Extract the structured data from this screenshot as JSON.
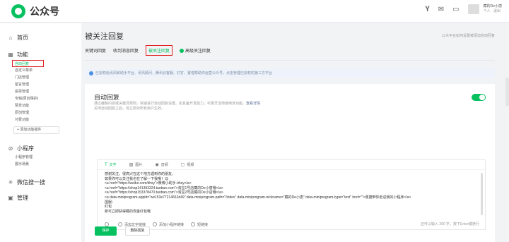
{
  "app": {
    "name": "公众号"
  },
  "topbar": {
    "icons": [
      "y-icon",
      "mail-icon",
      "monitor-icon"
    ],
    "user_name": "藏的De小唐",
    "user_sub": "个人 · 退出"
  },
  "sidebar": {
    "home": "首页",
    "features": "功能",
    "feature_items": [
      "自动回复",
      "自定义菜单",
      "门店管理",
      "留言管理",
      "投票管理",
      "专辑(原创保护)",
      "赞赏功能",
      "原创管理",
      "付费功能"
    ],
    "plugin_button": "+ 添加功能插件",
    "mini_program": "小程序",
    "mini_items": [
      "小程序管理",
      "展示场景"
    ],
    "search": "微信搜一搜",
    "manage": "管理"
  },
  "main": {
    "title": "被关注回复",
    "top_link": "公众平台如何设置被添加自动回复",
    "tabs": [
      "关键词回复",
      "收到消息回复",
      "被关注回复",
      "高级关注回复"
    ],
    "notice": "已授权给讯风和助手平台、讯风顾问、腾讯云客服、钉钉、置惜帮助你运营公众号，点击管理已授权的第三方平台"
  },
  "card": {
    "title": "自动回复",
    "desc1": "通过编辑内容或关键词规则，快速进行自动回复设置。如具备开发能力，可更灵活地使用该功能。",
    "desc_link": "查看详情",
    "desc2": "关闭自动回复之后，将立即对所有用户生效。"
  },
  "editor": {
    "toolbar": [
      "文字",
      "图片",
      "音频",
      "视频"
    ],
    "lines": [
      "感谢关注，很高兴在这个地方遇到你的朋友。",
      "如果你可以关注我也在了解一下我哦！😊",
      "<a href=\"https://weibo.com/tihsy\">微博小助手-tihsy</a>",
      "<a href=\"https://shop141393324.taobao.com\">淘宝1号店藏的De小唐哦</a>",
      "<a href=\"https://shop153378470.taobao.com\">淘宝2号店藏的De小店哦</a>",
      "<a data-miniprogram-appid=\"wx153e77214662d49\" data-miniprogram-path=\"/index\" data-miniprogram-nickname=\"藏的De小唐\" data-miniprogram-type=\"text\" href=\"\">便捷带你走进我的小程序</a>",
      "国服：",
      "红包",
      "新可立即获得藏的现金红包哦"
    ],
    "footer": [
      "添加文字链接",
      "添加小程序链接",
      "短链接"
    ],
    "counter": "还可以输入 200 字，按下Enter键换行"
  },
  "buttons": {
    "save": "保存",
    "delete": "删除回复"
  }
}
